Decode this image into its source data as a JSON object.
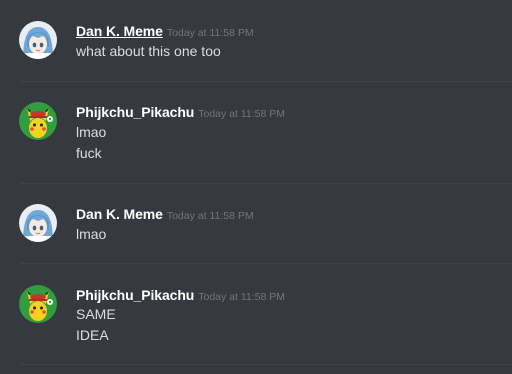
{
  "messages": [
    {
      "author": "Dan K. Meme",
      "timestamp": "Today at 11:58 PM",
      "avatar_icon": "anime-girl-avatar-icon",
      "lines": [
        "what about this one too"
      ]
    },
    {
      "author": "Phijkchu_Pikachu",
      "timestamp": "Today at 11:58 PM",
      "avatar_icon": "pikachu-avatar-icon",
      "lines": [
        "lmao",
        "fuck"
      ]
    },
    {
      "author": "Dan K. Meme",
      "timestamp": "Today at 11:58 PM",
      "avatar_icon": "anime-girl-avatar-icon",
      "lines": [
        "lmao"
      ]
    },
    {
      "author": "Phijkchu_Pikachu",
      "timestamp": "Today at 11:58 PM",
      "avatar_icon": "pikachu-avatar-icon",
      "lines": [
        "SAME",
        "IDEA"
      ]
    }
  ],
  "colors": {
    "background": "#36393f",
    "username": "#ffffff",
    "message_text": "#dcddde",
    "timestamp": "#72767d",
    "divider": "#3f4248"
  }
}
